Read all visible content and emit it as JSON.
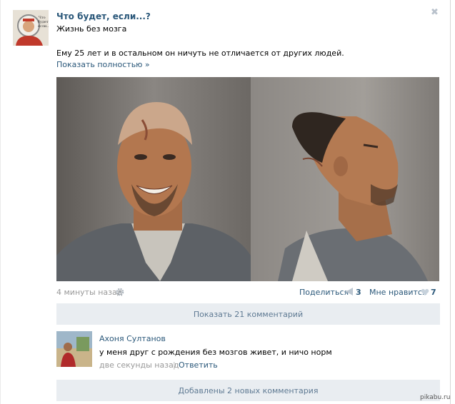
{
  "post": {
    "group_title": "Что будет, если...?",
    "subtitle": "Жизнь без мозга",
    "text": "Ему 25 лет и в остальном он ничуть не отличается от других людей.",
    "show_more": "Показать полностью »",
    "close_glyph": "✖",
    "time": "4 минуты назад",
    "share_label": "Поделиться",
    "share_count": "3",
    "like_label": "Мне нравится",
    "like_count": "7"
  },
  "comments": {
    "show_all_label": "Показать 21 комментарий",
    "added_label": "Добавлены 2 новых комментария",
    "items": [
      {
        "author": "Ахоня Султанов",
        "text": "у меня друг с рождения без мозгов живет, и ничо норм",
        "time": "две секунды назад",
        "separator": "|",
        "reply": "Ответить"
      }
    ]
  },
  "watermark": "pikabu.ru",
  "colors": {
    "link": "#2b587a",
    "bar_bg": "#e9edf1",
    "muted": "#999999"
  },
  "icons": [
    "close-icon",
    "gear-icon",
    "megaphone-icon",
    "heart-icon"
  ]
}
